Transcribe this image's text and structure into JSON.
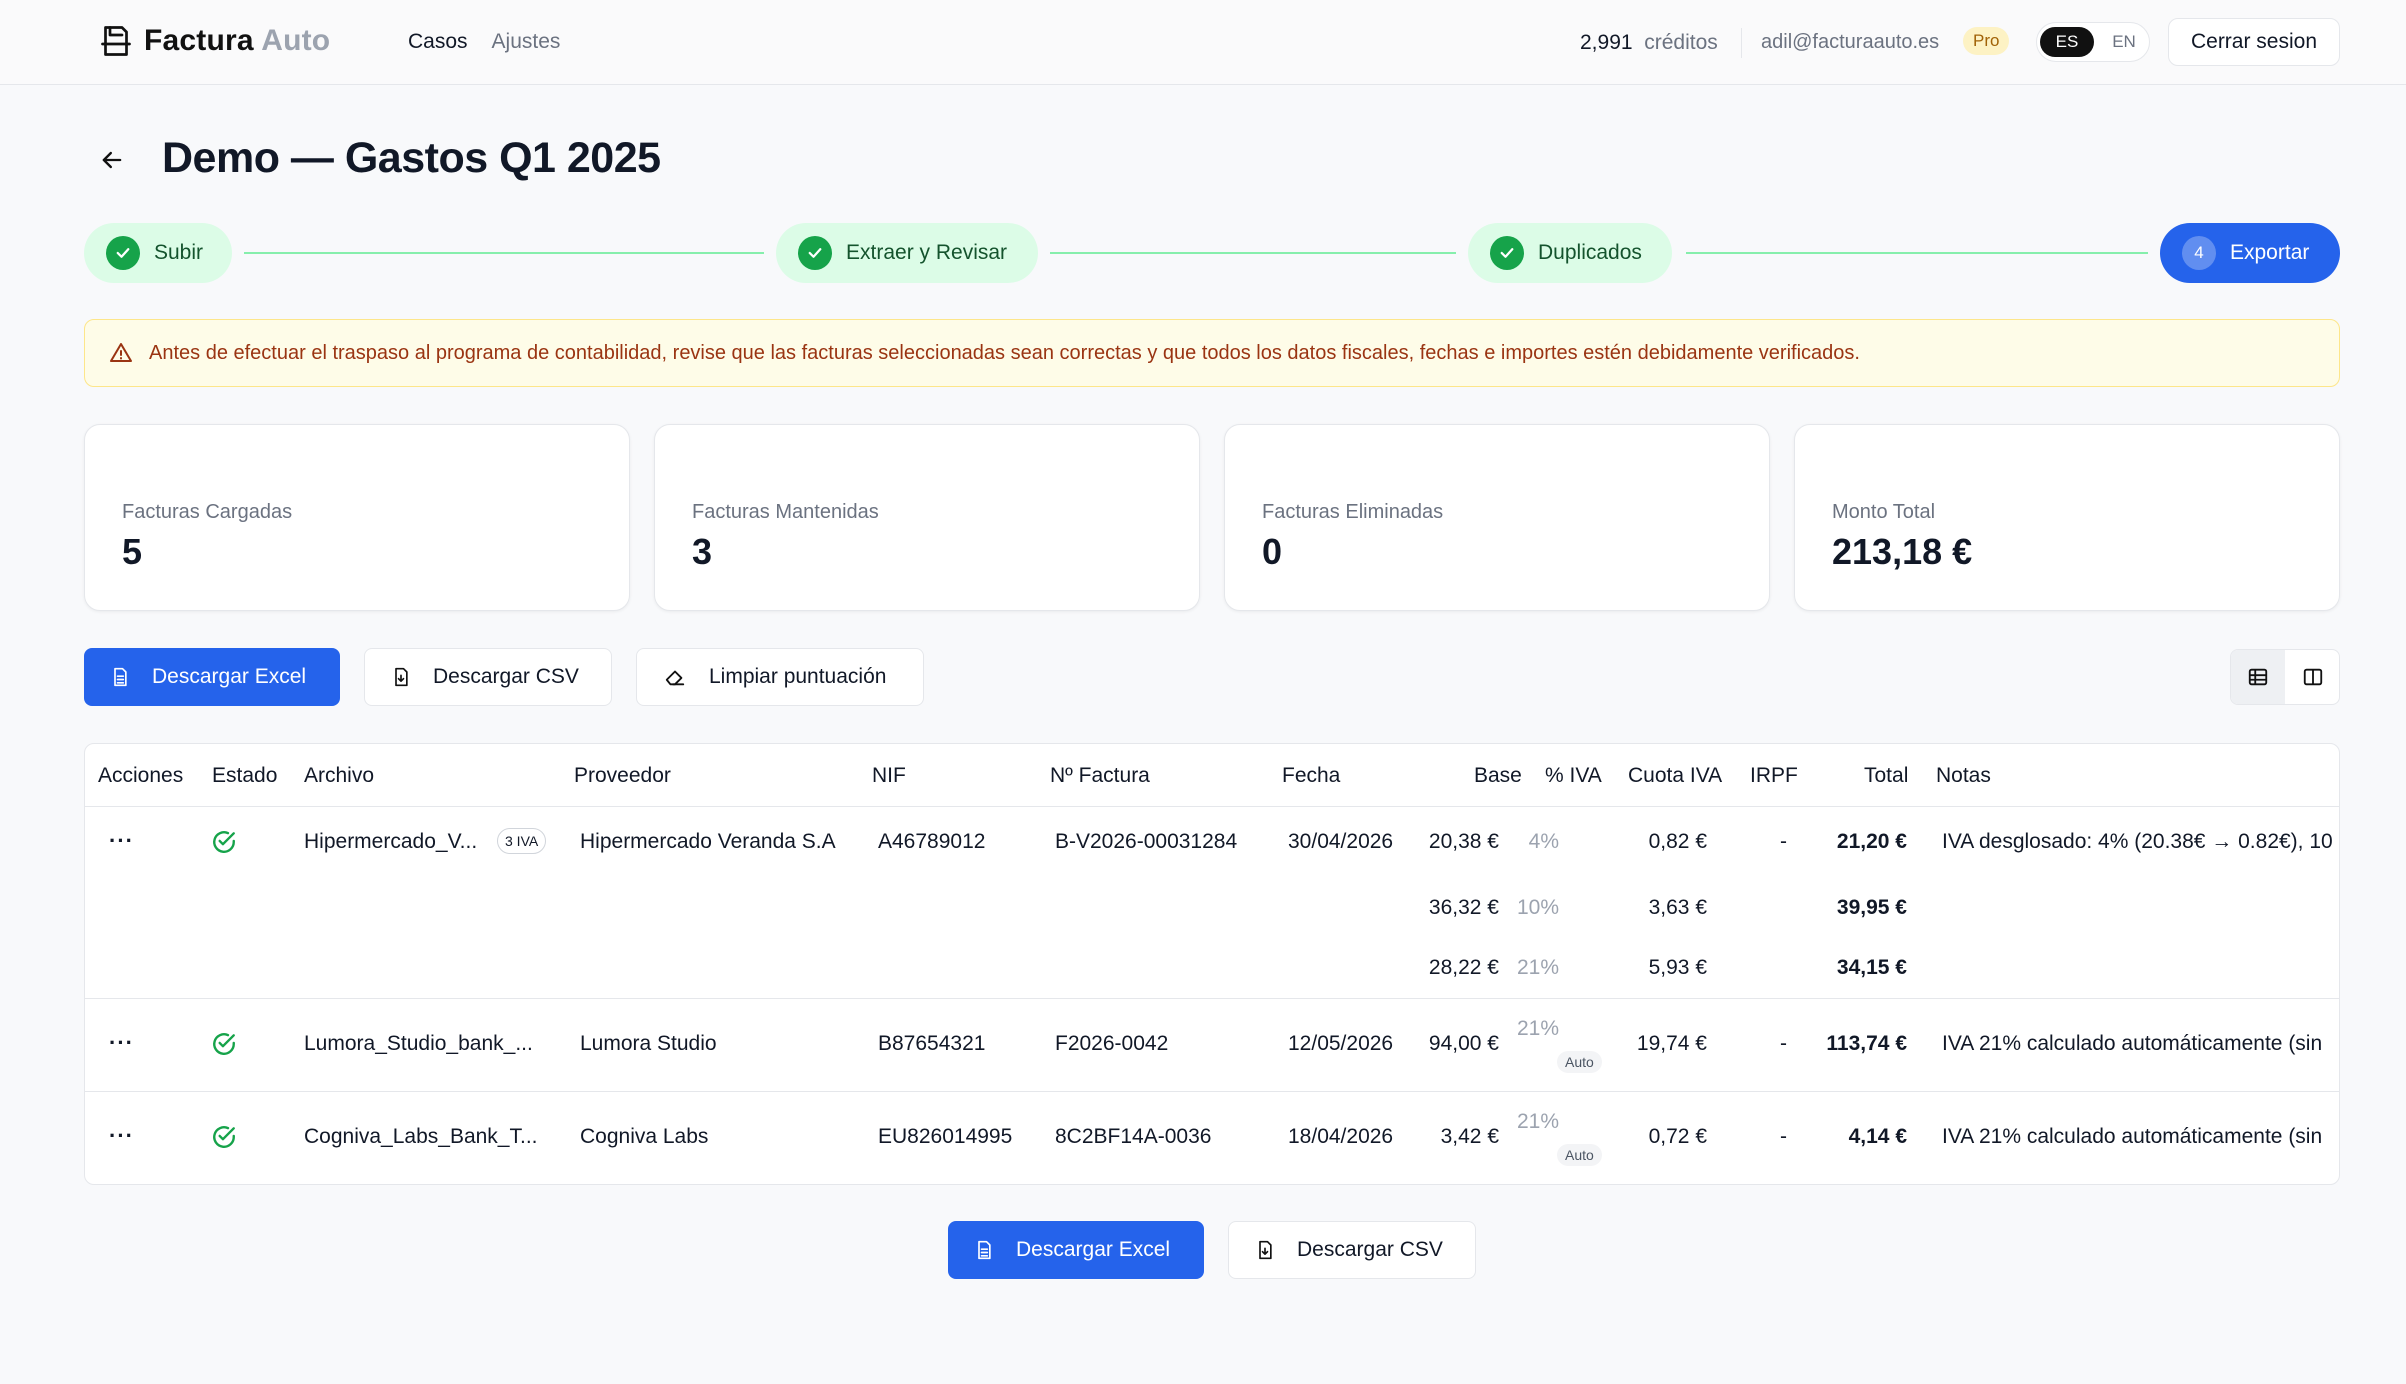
{
  "header": {
    "brand_main": "Factura",
    "brand_light": "Auto",
    "nav": [
      "Casos",
      "Ajustes"
    ],
    "credits_value": "2,991",
    "credits_label": "créditos",
    "email": "adil@facturaauto.es",
    "plan": "Pro",
    "lang_active": "ES",
    "lang_other": "EN",
    "logout": "Cerrar sesion"
  },
  "page": {
    "title": "Demo — Gastos Q1 2025"
  },
  "steps": [
    {
      "label": "Subir",
      "status": "done"
    },
    {
      "label": "Extraer y Revisar",
      "status": "done"
    },
    {
      "label": "Duplicados",
      "status": "done"
    },
    {
      "number": "4",
      "label": "Exportar",
      "status": "current"
    }
  ],
  "warning": "Antes de efectuar el traspaso al programa de contabilidad, revise que las facturas seleccionadas sean correctas y que todos los datos fiscales, fechas e importes estén debidamente verificados.",
  "stats": [
    {
      "label": "Facturas Cargadas",
      "value": "5"
    },
    {
      "label": "Facturas Mantenidas",
      "value": "3"
    },
    {
      "label": "Facturas Eliminadas",
      "value": "0"
    },
    {
      "label": "Monto Total",
      "value": "213,18 €"
    }
  ],
  "actions": {
    "excel": "Descargar Excel",
    "csv": "Descargar CSV",
    "clear": "Limpiar puntuación"
  },
  "table": {
    "columns": [
      "Acciones",
      "Estado",
      "Archivo",
      "Proveedor",
      "NIF",
      "Nº Factura",
      "Fecha",
      "Base",
      "% IVA",
      "Cuota IVA",
      "IRPF",
      "Total",
      "Notas"
    ],
    "rows": [
      {
        "archivo": "Hipermercado_V...",
        "iva_badge": "3 IVA",
        "proveedor": "Hipermercado Veranda S.A",
        "nif": "A46789012",
        "factura": "B-V2026-00031284",
        "fecha": "30/04/2026",
        "irpf": "-",
        "notas": "IVA desglosado: 4% (20.38€ → 0.82€), 10",
        "lines": [
          {
            "base": "20,38 €",
            "iva": "4%",
            "cuota": "0,82 €",
            "total": "21,20 €"
          },
          {
            "base": "36,32 €",
            "iva": "10%",
            "cuota": "3,63 €",
            "total": "39,95 €"
          },
          {
            "base": "28,22 €",
            "iva": "21%",
            "cuota": "5,93 €",
            "total": "34,15 €"
          }
        ]
      },
      {
        "archivo": "Lumora_Studio_bank_...",
        "proveedor": "Lumora Studio",
        "nif": "B87654321",
        "factura": "F2026-0042",
        "fecha": "12/05/2026",
        "base": "94,00 €",
        "iva": "21%",
        "iva_tag": "Auto",
        "cuota": "19,74 €",
        "irpf": "-",
        "total": "113,74 €",
        "notas": "IVA 21% calculado automáticamente (sin"
      },
      {
        "archivo": "Cogniva_Labs_Bank_T...",
        "proveedor": "Cogniva Labs",
        "nif": "EU826014995",
        "factura": "8C2BF14A-0036",
        "fecha": "18/04/2026",
        "base": "3,42 €",
        "iva": "21%",
        "iva_tag": "Auto",
        "cuota": "0,72 €",
        "irpf": "-",
        "total": "4,14 €",
        "notas": "IVA 21% calculado automáticamente (sin"
      }
    ]
  },
  "colors": {
    "primary": "#2563eb",
    "success": "#16a34a",
    "warning_bg": "#fefce8",
    "warning_text": "#9a3412"
  }
}
